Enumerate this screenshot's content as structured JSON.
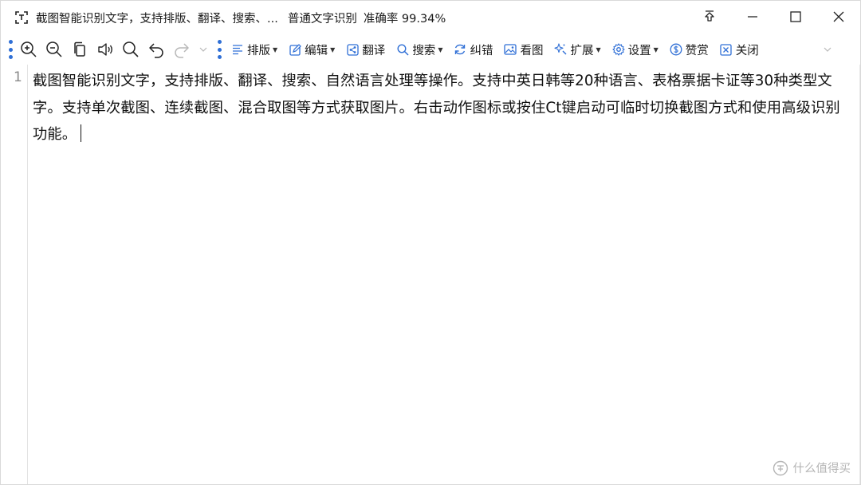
{
  "titlebar": {
    "title": "截图智能识别文字，支持排版、翻译、搜索、...",
    "mode": "普通文字识别",
    "accuracy": "准确率 99.34%"
  },
  "toolbar": {
    "icons": [
      "zoom-in-icon",
      "zoom-out-icon",
      "copy-icon",
      "speaker-icon",
      "search-icon",
      "undo-icon",
      "redo-icon"
    ],
    "items": [
      {
        "label": "排版",
        "icon": "format-icon",
        "dropdown": true
      },
      {
        "label": "编辑",
        "icon": "edit-icon",
        "dropdown": true
      },
      {
        "label": "翻译",
        "icon": "translate-icon",
        "dropdown": false
      },
      {
        "label": "搜索",
        "icon": "search-icon",
        "dropdown": true
      },
      {
        "label": "纠错",
        "icon": "refresh-icon",
        "dropdown": false
      },
      {
        "label": "看图",
        "icon": "image-icon",
        "dropdown": false
      },
      {
        "label": "扩展",
        "icon": "sparkle-icon",
        "dropdown": true
      },
      {
        "label": "设置",
        "icon": "gear-icon",
        "dropdown": true
      },
      {
        "label": "赞赏",
        "icon": "coin-icon",
        "dropdown": false
      },
      {
        "label": "关闭",
        "icon": "close-box-icon",
        "dropdown": false
      }
    ]
  },
  "editor": {
    "line_number": "1",
    "text": "截图智能识别文字，支持排版、翻译、搜索、自然语言处理等操作。支持中英日韩等20种语言、表格票据卡证等30种类型文字。支持单次截图、连续截图、混合取图等方式获取图片。右击动作图标或按住Ct键启动可临时切换截图方式和使用高级识别功能。"
  },
  "watermark": {
    "text": "什么值得买"
  },
  "colors": {
    "accent": "#2f6fd6",
    "text": "#1a1a1a",
    "gutter_text": "#8a8a8a",
    "watermark": "#b5b5b5"
  }
}
